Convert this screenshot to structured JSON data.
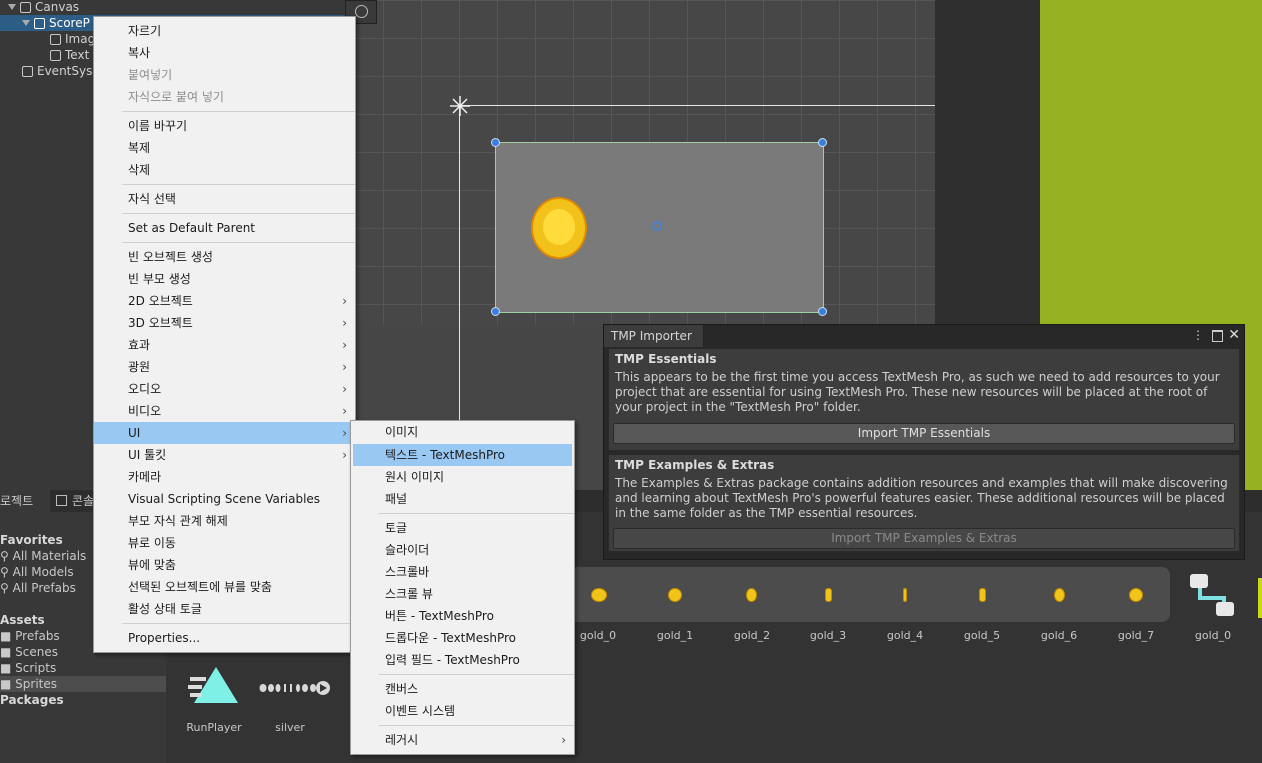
{
  "hierarchy": {
    "items": [
      {
        "label": "Canvas"
      },
      {
        "label": "ScoreP"
      },
      {
        "label": "Imag"
      },
      {
        "label": "Text"
      },
      {
        "label": "EventSys"
      }
    ]
  },
  "project": {
    "tabs": [
      "로젝트",
      "콘솔"
    ],
    "favorites_header": "Favorites",
    "favorites": [
      "All Materials",
      "All Models",
      "All Prefabs"
    ],
    "assets_header": "Assets",
    "assets": [
      "Prefabs",
      "Scenes",
      "Scripts",
      "Sprites"
    ],
    "packages_header": "Packages",
    "asset_items": [
      {
        "label": "RunPlayer"
      },
      {
        "label": "silver"
      }
    ],
    "gold_labels": [
      "gold_0",
      "gold_1",
      "gold_2",
      "gold_3",
      "gold_4",
      "gold_5",
      "gold_6",
      "gold_7",
      "gold_0"
    ]
  },
  "context_menu": {
    "items": [
      {
        "label": "자르기"
      },
      {
        "label": "복사"
      },
      {
        "label": "붙여넣기"
      },
      {
        "label": "자식으로 붙여 넣기"
      },
      {
        "label": "이름 바꾸기"
      },
      {
        "label": "복제"
      },
      {
        "label": "삭제"
      },
      {
        "label": "자식 선택"
      },
      {
        "label": "Set as Default Parent"
      },
      {
        "label": "빈 오브젝트 생성"
      },
      {
        "label": "빈 부모 생성"
      },
      {
        "label": "2D 오브젝트"
      },
      {
        "label": "3D 오브젝트"
      },
      {
        "label": "효과"
      },
      {
        "label": "광원"
      },
      {
        "label": "오디오"
      },
      {
        "label": "비디오"
      },
      {
        "label": "UI"
      },
      {
        "label": "UI 툴킷"
      },
      {
        "label": "카메라"
      },
      {
        "label": "Visual Scripting Scene Variables"
      },
      {
        "label": "부모 자식 관계 해제"
      },
      {
        "label": "뷰로 이동"
      },
      {
        "label": "뷰에 맞춤"
      },
      {
        "label": "선택된 오브젝트에 뷰를 맞춤"
      },
      {
        "label": "활성 상태 토글"
      },
      {
        "label": "Properties..."
      }
    ],
    "arrow": "›"
  },
  "ui_submenu": {
    "items": [
      {
        "label": "이미지"
      },
      {
        "label": "텍스트 - TextMeshPro"
      },
      {
        "label": "원시 이미지"
      },
      {
        "label": "패널"
      },
      {
        "label": "토글"
      },
      {
        "label": "슬라이더"
      },
      {
        "label": "스크롤바"
      },
      {
        "label": "스크롤 뷰"
      },
      {
        "label": "버튼 - TextMeshPro"
      },
      {
        "label": "드롭다운 - TextMeshPro"
      },
      {
        "label": "입력 필드 - TextMeshPro"
      },
      {
        "label": "캔버스"
      },
      {
        "label": "이벤트 시스템"
      },
      {
        "label": "레거시"
      }
    ]
  },
  "tmp_importer": {
    "tab_label": "TMP Importer",
    "essentials_title": "TMP Essentials",
    "essentials_text": "This appears to be the first time you access TextMesh Pro, as such we need to add resources to your project that are essential for using TextMesh Pro. These new resources will be placed at the root of your project in the \"TextMesh Pro\" folder.",
    "essentials_button": "Import TMP Essentials",
    "examples_title": "TMP Examples & Extras",
    "examples_text": "The Examples & Extras package contains addition resources and examples that will make discovering and learning about TextMesh Pro's powerful features easier. These additional resources will be placed in the same folder as the TMP essential resources.",
    "examples_button": "Import TMP Examples & Extras"
  },
  "colors": {
    "menu_highlight": "#99c9f3",
    "selection": "#2c5d87",
    "game_green": "#96b221",
    "coin_gold": "#f0c419"
  }
}
